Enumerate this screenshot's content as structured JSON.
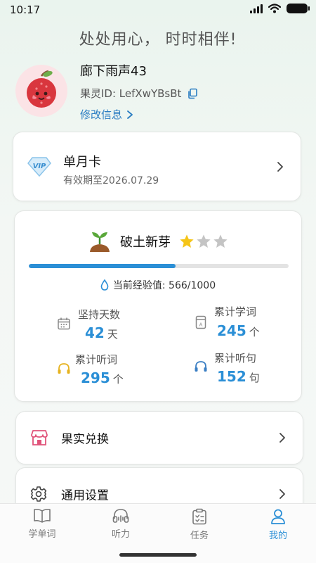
{
  "status_bar": {
    "time": "10:17"
  },
  "slogan": "处处用心， 时时相伴!",
  "profile": {
    "nickname": "廊下雨声43",
    "uid": "果灵ID: LefXwYBsBt",
    "edit_label": "修改信息"
  },
  "vip": {
    "title": "单月卡",
    "expiry": "有效期至2026.07.29",
    "badge_text": "VIP"
  },
  "level": {
    "name": "破土新芽",
    "stars_filled": 1,
    "stars_total": 3,
    "progress": 0.566,
    "exp_text": "当前经验值: 566/1000"
  },
  "stats": [
    {
      "label": "坚持天数",
      "value": "42",
      "unit": "天",
      "icon": "calendar-icon"
    },
    {
      "label": "累计学词",
      "value": "245",
      "unit": "个",
      "icon": "word-card-icon"
    },
    {
      "label": "累计听词",
      "value": "295",
      "unit": "个",
      "icon": "headphones-icon"
    },
    {
      "label": "累计听句",
      "value": "152",
      "unit": "句",
      "icon": "headphones-icon"
    }
  ],
  "menu": [
    {
      "label": "果实兑换",
      "icon": "shop-icon"
    },
    {
      "label": "通用设置",
      "icon": "gear-icon"
    }
  ],
  "nav": [
    {
      "label": "学单词",
      "icon": "book-icon",
      "active": false
    },
    {
      "label": "听力",
      "icon": "headphones-icon",
      "active": false
    },
    {
      "label": "任务",
      "icon": "clipboard-icon",
      "active": false
    },
    {
      "label": "我的",
      "icon": "person-icon",
      "active": true
    }
  ],
  "colors": {
    "accent": "#2b8fd6",
    "link": "#2a7dc2",
    "star": "#f5c518",
    "shop": "#e0537a"
  }
}
